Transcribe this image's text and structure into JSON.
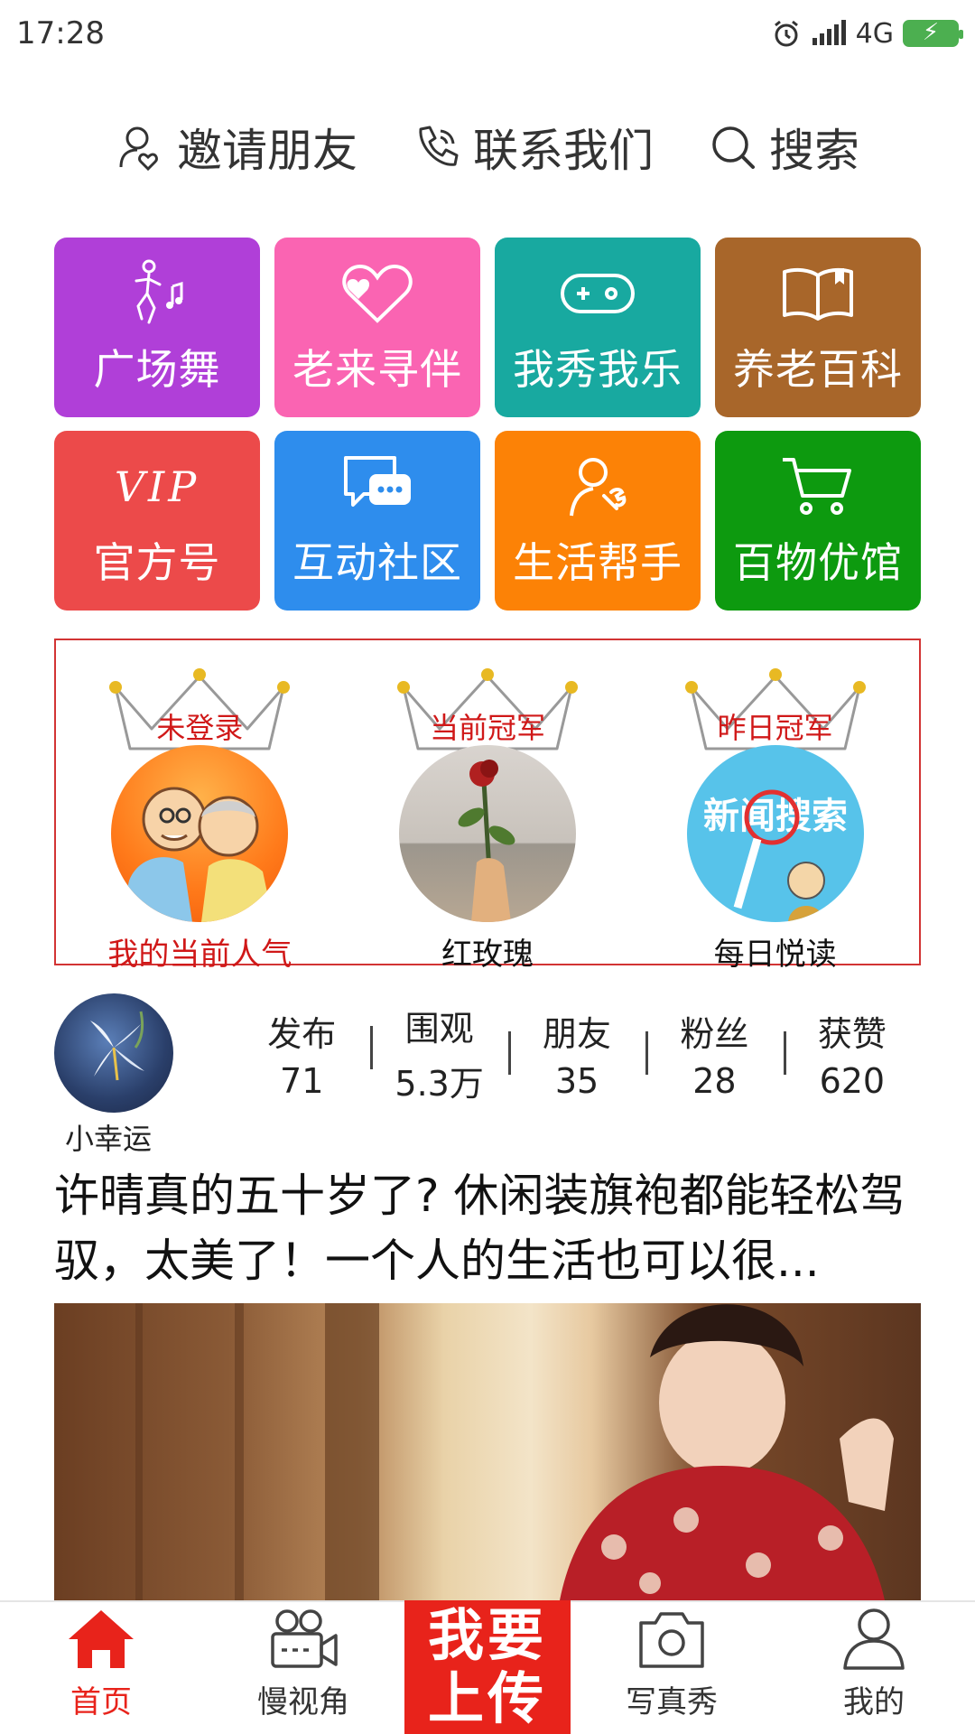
{
  "status_bar": {
    "time": "17:28",
    "network": "4G"
  },
  "top_actions": [
    {
      "label": "邀请朋友",
      "icon": "invite-user-icon"
    },
    {
      "label": "联系我们",
      "icon": "phone-icon"
    },
    {
      "label": "搜索",
      "icon": "search-icon"
    }
  ],
  "tiles": [
    {
      "label": "广场舞",
      "icon": "dancer-icon",
      "color": "#b03fd8"
    },
    {
      "label": "老来寻伴",
      "icon": "heart-icon",
      "color": "#fa64b2"
    },
    {
      "label": "我秀我乐",
      "icon": "gamepad-icon",
      "color": "#18a9a0"
    },
    {
      "label": "养老百科",
      "icon": "book-icon",
      "color": "#a8662a"
    },
    {
      "label": "官方号",
      "icon": "vip-icon",
      "icon_text": "VIP",
      "color": "#ec4a4a"
    },
    {
      "label": "互动社区",
      "icon": "chat-icon",
      "color": "#2e8ded"
    },
    {
      "label": "生活帮手",
      "icon": "helper-icon",
      "color": "#fc8206"
    },
    {
      "label": "百物优馆",
      "icon": "cart-icon",
      "color": "#0d9a0f"
    }
  ],
  "rankings": [
    {
      "crown_text": "未登录",
      "label": "我的当前人气"
    },
    {
      "crown_text": "当前冠军",
      "label": "红玫瑰"
    },
    {
      "crown_text": "昨日冠军",
      "label": "每日悦读",
      "image_text": "新闻搜索"
    }
  ],
  "profile": {
    "name": "小幸运",
    "stats": [
      {
        "label": "发布",
        "value": "71"
      },
      {
        "label": "围观",
        "value": "5.3万"
      },
      {
        "label": "朋友",
        "value": "35"
      },
      {
        "label": "粉丝",
        "value": "28"
      },
      {
        "label": "获赞",
        "value": "620"
      }
    ]
  },
  "article": {
    "title": "许晴真的五十岁了? 休闲装旗袍都能轻松驾驭，太美了！一个人的生活也可以很..."
  },
  "bottom_nav": {
    "home": "首页",
    "video": "慢视角",
    "upload_line1": "我要",
    "upload_line2": "上传",
    "photo": "写真秀",
    "mine": "我的"
  },
  "colors": {
    "accent": "#e8231b",
    "rank_border": "#d23434"
  }
}
